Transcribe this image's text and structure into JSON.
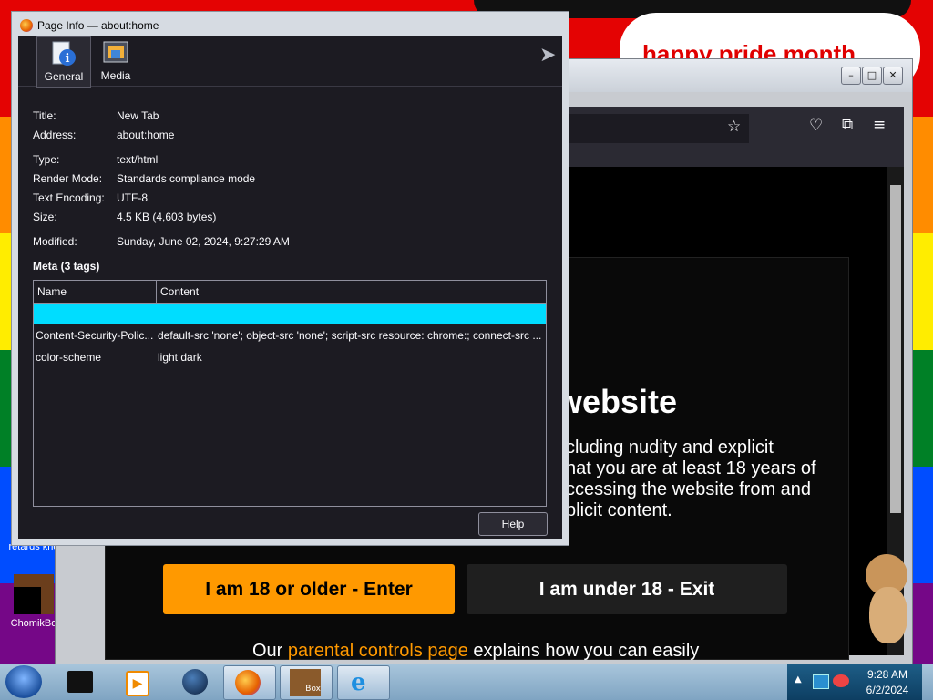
{
  "desktop": {
    "banner_text": "happy pride month",
    "icons": [
      {
        "label": "retards kno"
      },
      {
        "label": "ChomikBo"
      }
    ],
    "colors": {
      "red": "#e40303",
      "orange": "#ff8c00",
      "yellow": "#ffed00",
      "green": "#008026",
      "blue": "#004dff",
      "violet": "#750787"
    }
  },
  "firefox": {
    "window_controls": {
      "minimize": "–",
      "maximize": "□",
      "close": "✕"
    },
    "toolbar_icons": [
      "bookmark-star-icon",
      "pocket-icon",
      "extensions-icon",
      "menu-icon"
    ],
    "page": {
      "heading": "website",
      "paragraph_lines": [
        "cluding nudity and explicit",
        "hat you are at least 18 years of",
        "ccessing the website from and",
        "plicit content."
      ],
      "enter_button": "I am 18 or older - Enter",
      "exit_button": "I am under 18 - Exit",
      "footer_prefix": "Our ",
      "footer_link": "parental controls page",
      "footer_suffix": " explains how you can easily"
    }
  },
  "page_info": {
    "title": "Page Info — about:home",
    "tabs": [
      {
        "label": "General",
        "icon": "info-icon",
        "selected": true
      },
      {
        "label": "Media",
        "icon": "media-icon",
        "selected": false
      }
    ],
    "fields": {
      "title": {
        "label": "Title:",
        "value": "New Tab"
      },
      "address": {
        "label": "Address:",
        "value": "about:home"
      },
      "type": {
        "label": "Type:",
        "value": "text/html"
      },
      "render_mode": {
        "label": "Render Mode:",
        "value": "Standards compliance mode"
      },
      "text_encoding": {
        "label": "Text Encoding:",
        "value": "UTF-8"
      },
      "size": {
        "label": "Size:",
        "value": "4.5 KB (4,603 bytes)"
      },
      "modified": {
        "label": "Modified:",
        "value": "Sunday, June 02, 2024, 9:27:29 AM"
      }
    },
    "meta_heading": "Meta (3 tags)",
    "meta_columns": [
      "Name",
      "Content"
    ],
    "meta_rows": [
      {
        "name": "",
        "content": ""
      },
      {
        "name": "Content-Security-Polic...",
        "content": "default-src 'none'; object-src 'none'; script-src resource: chrome:; connect-src ..."
      },
      {
        "name": "color-scheme",
        "content": "light dark"
      }
    ],
    "help_button": "Help"
  },
  "taskbar": {
    "time": "9:28 AM",
    "date": "6/2/2024",
    "box_label": "Box"
  }
}
